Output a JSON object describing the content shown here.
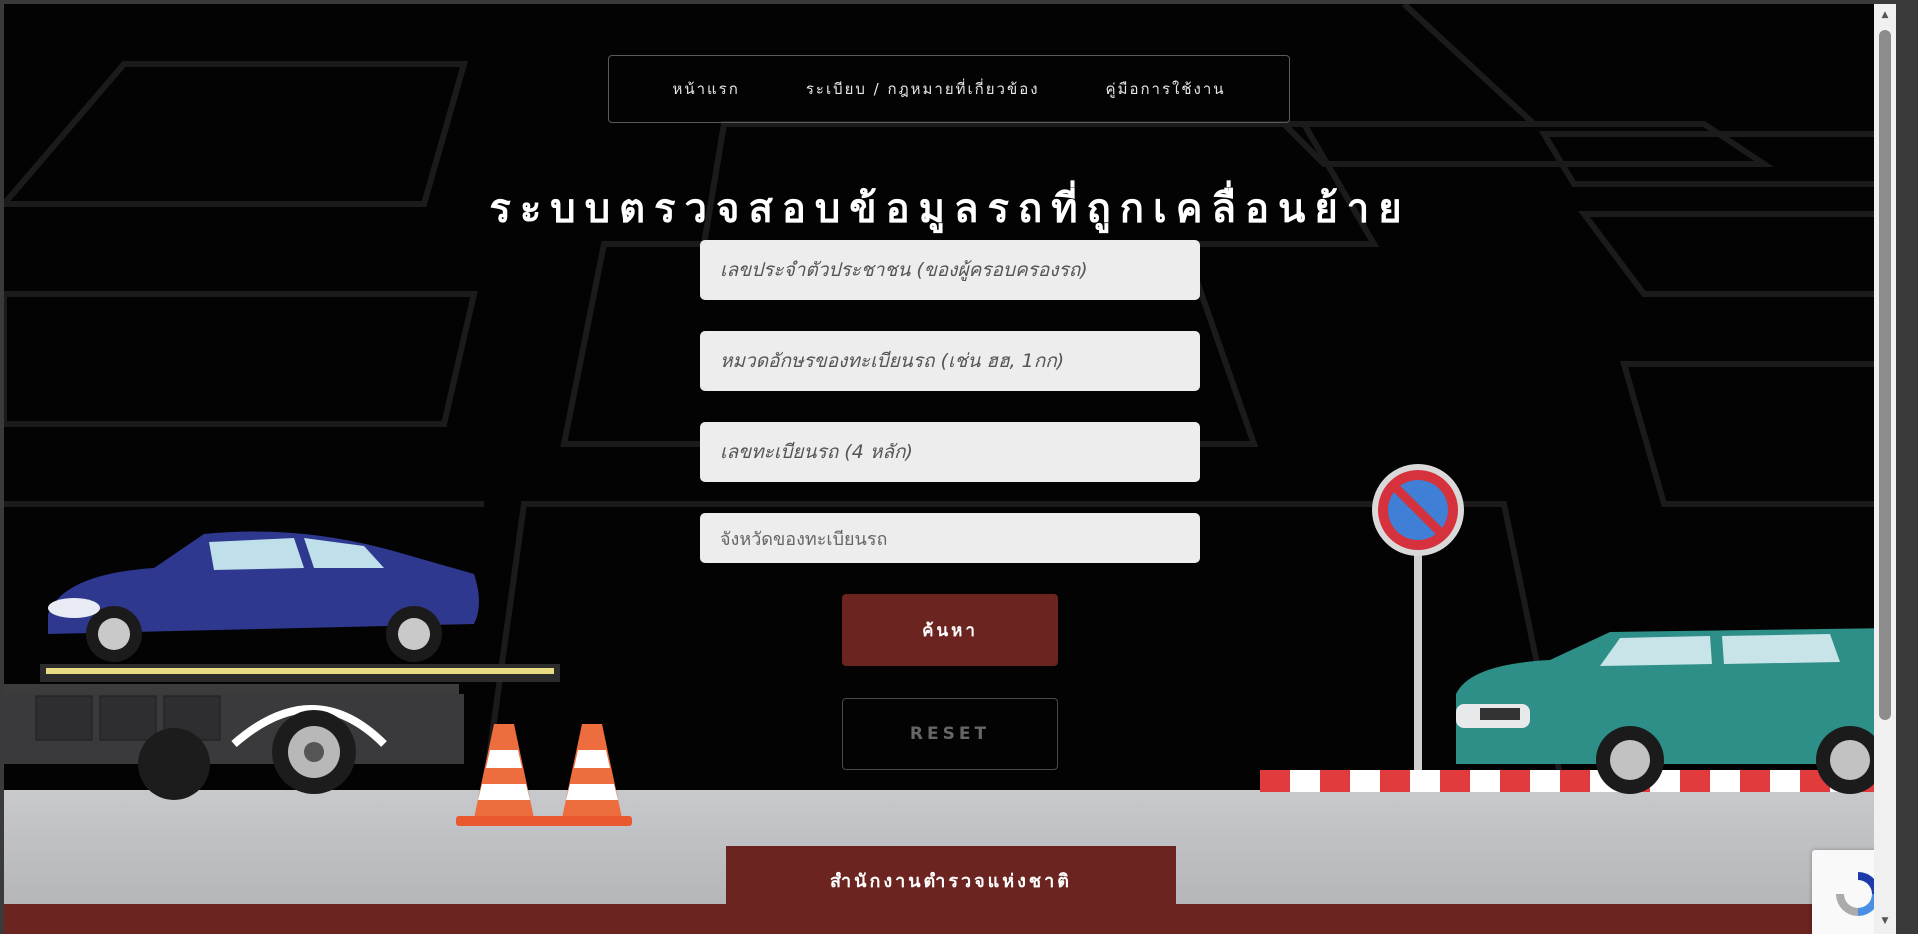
{
  "nav": {
    "home": "หน้าแรก",
    "laws": "ระเบียบ / กฎหมายที่เกี่ยวข้อง",
    "manual": "คู่มือการใช้งาน"
  },
  "page_title": "ระบบตรวจสอบข้อมูลรถที่ถูกเคลื่อนย้าย",
  "form": {
    "id_card_placeholder": "เลขประจำตัวประชาชน (ของผู้ครอบครองรถ)",
    "plate_prefix_placeholder": "หมวดอักษรของทะเบียนรถ (เช่น ฮฮ, 1กก)",
    "plate_number_placeholder": "เลขทะเบียนรถ (4 หลัก)",
    "province_placeholder": "จังหวัดของทะเบียนรถ",
    "search_label": "ค้นหา",
    "reset_label": "RESET"
  },
  "footer": {
    "org_name": "สำนักงานตำรวจแห่งชาติ"
  },
  "colors": {
    "accent": "#6b241f",
    "background": "#030303",
    "input_bg": "#ededed"
  }
}
